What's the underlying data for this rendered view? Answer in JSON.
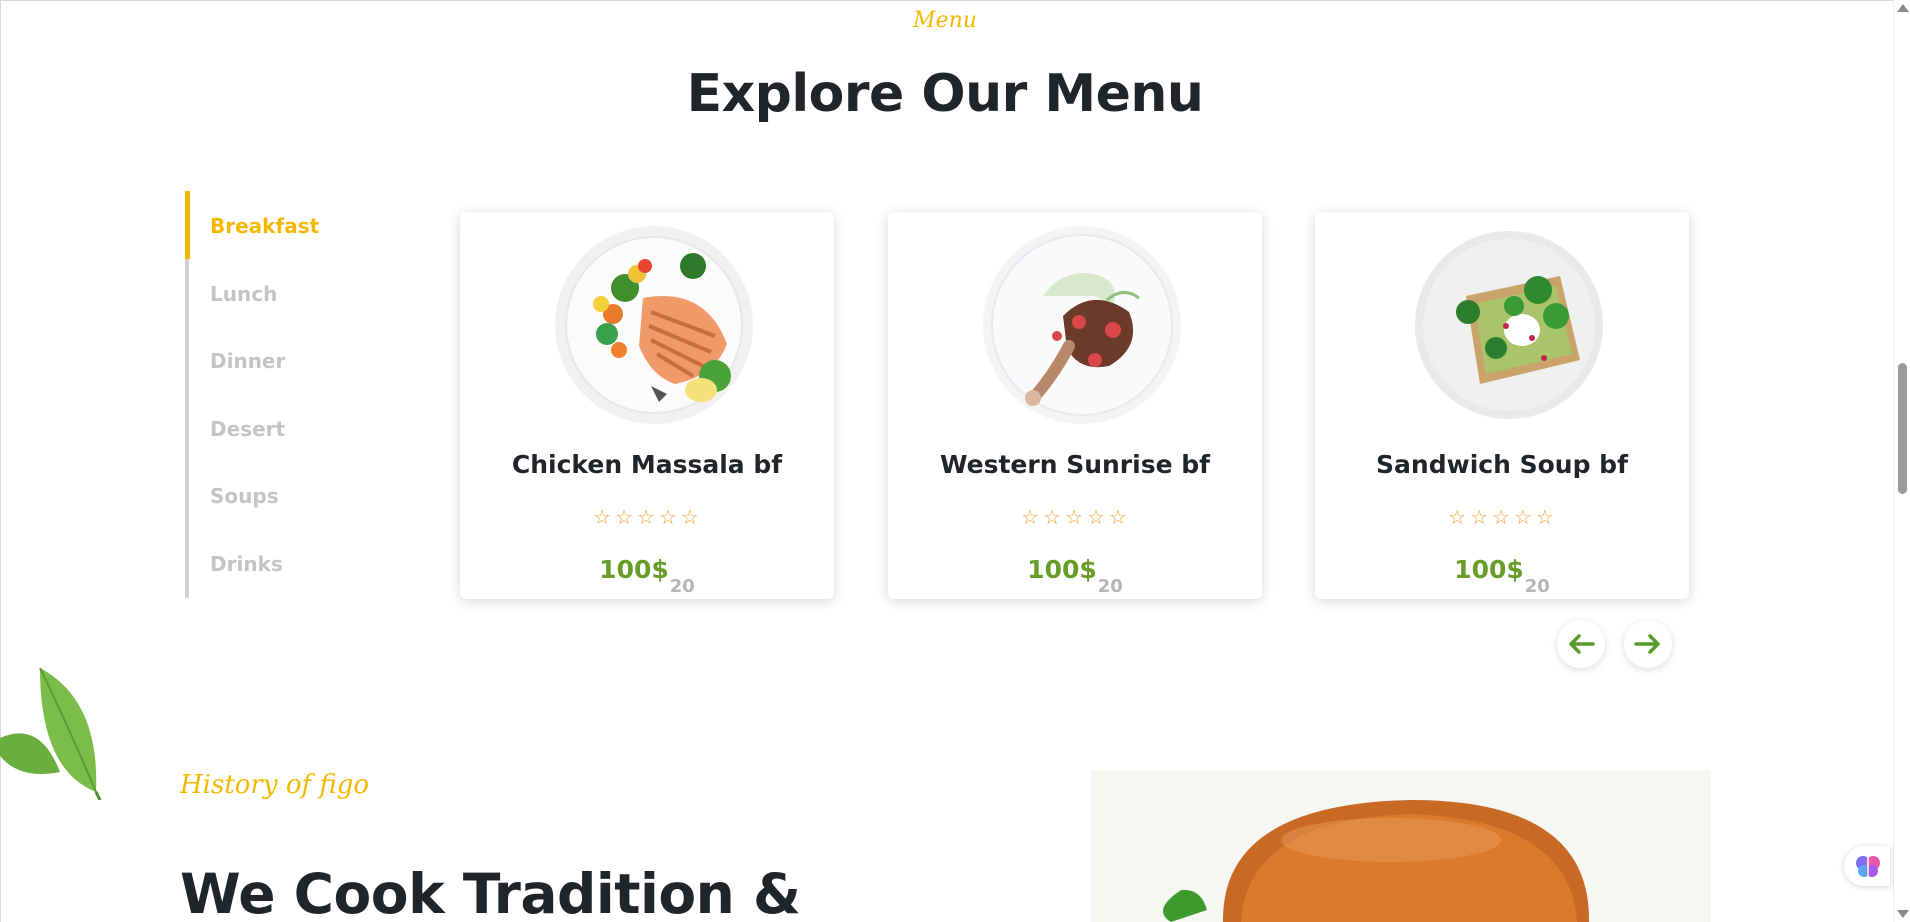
{
  "section": {
    "eyebrow": "Menu",
    "title": "Explore Our Menu"
  },
  "categories": {
    "active_index": 0,
    "items": [
      {
        "label": "Breakfast"
      },
      {
        "label": "Lunch"
      },
      {
        "label": "Dinner"
      },
      {
        "label": "Desert"
      },
      {
        "label": "Soups"
      },
      {
        "label": "Drinks"
      }
    ]
  },
  "cards": [
    {
      "title": "Chicken Massala bf",
      "rating": 0,
      "price": "100$",
      "quantity": "20",
      "image": "grilled-salmon-with-vegetables"
    },
    {
      "title": "Western Sunrise bf",
      "rating": 0,
      "price": "100$",
      "quantity": "20",
      "image": "roasted-chicken-leg"
    },
    {
      "title": "Sandwich Soup bf",
      "rating": 0,
      "price": "100$",
      "quantity": "20",
      "image": "avocado-toast-with-greens"
    }
  ],
  "icons": {
    "prev": "arrow-left-icon",
    "next": "arrow-right-icon",
    "star": "star-outline-icon",
    "leaf": "basil-leaf-icon",
    "assistant": "brain-icon"
  },
  "history": {
    "eyebrow": "History of figo",
    "heading": "We Cook Tradition &"
  },
  "colors": {
    "accent": "#f5b800",
    "price": "#6a9c2a",
    "heading": "#212529",
    "muted": "#c4c4c4"
  }
}
